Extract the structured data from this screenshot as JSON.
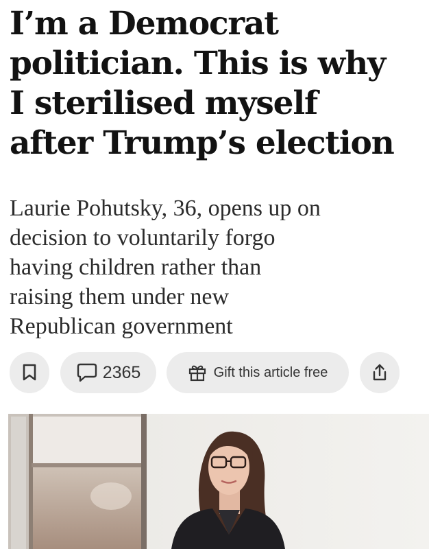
{
  "article": {
    "headline_lines": [
      "I’m a Democrat",
      "politician. This is why",
      "I sterilised myself",
      "after Trump’s election"
    ],
    "standfirst_lines": [
      "Laurie Pohutsky, 36, opens up on",
      "decision to voluntarily forgo",
      "having children rather than",
      "raising them under new",
      "Republican government"
    ]
  },
  "actions": {
    "save_icon": "bookmark-icon",
    "comments_icon": "speech-bubble-icon",
    "comments_count": "2365",
    "gift_icon": "gift-icon",
    "gift_label": "Gift this article free",
    "share_icon": "share-upload-icon"
  },
  "colors": {
    "text": "#121212",
    "pill_background": "#ececec",
    "icon": "#333333"
  },
  "image": {
    "subject": "portrait-photo"
  }
}
